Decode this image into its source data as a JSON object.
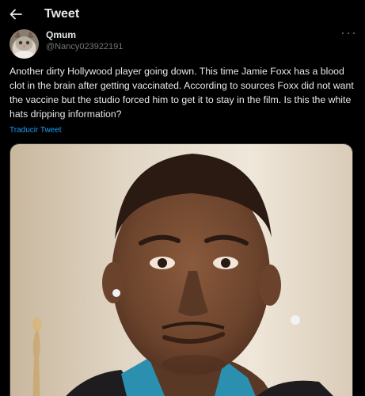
{
  "header": {
    "title": "Tweet",
    "back_icon": "arrow-left-icon"
  },
  "author": {
    "display_name": "Qmum",
    "handle": "@Nancy023922191",
    "more_icon": "more-horizontal-icon"
  },
  "tweet": {
    "text": "Another dirty Hollywood player going down. This time Jamie Foxx has a blood clot in the brain after getting vaccinated.  According to sources Foxx did not want the vaccine but the studio forced him to get it to stay in the film. Is this the white hats dripping information?",
    "translate_label": "Traducir Tweet"
  },
  "colors": {
    "background": "#000000",
    "text_primary": "#e7e9ea",
    "text_secondary": "#71767b",
    "link": "#1d9bf0"
  }
}
